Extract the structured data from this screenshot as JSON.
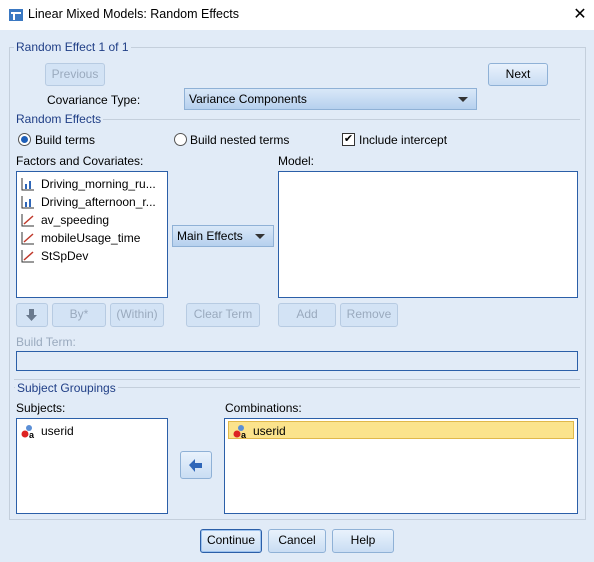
{
  "window": {
    "title": "Linear Mixed Models: Random Effects",
    "close": "✕"
  },
  "random_effect": {
    "group_title": "Random Effect 1 of 1",
    "previous": "Previous",
    "next": "Next",
    "covariance_label": "Covariance Type:",
    "covariance_value": "Variance Components"
  },
  "random_effects": {
    "group_title": "Random Effects",
    "build_terms": "Build terms",
    "build_nested": "Build nested terms",
    "include_intercept": "Include intercept",
    "include_intercept_checked": true,
    "selected_mode": "Build terms",
    "factors_label": "Factors and Covariates:",
    "factors": [
      {
        "name": "Driving_morning_ru...",
        "icon": "ordinal-icon"
      },
      {
        "name": "Driving_afternoon_r...",
        "icon": "ordinal-icon"
      },
      {
        "name": "av_speeding",
        "icon": "scale-icon"
      },
      {
        "name": "mobileUsage_time",
        "icon": "scale-icon"
      },
      {
        "name": "StSpDev",
        "icon": "scale-icon"
      }
    ],
    "term_type": "Main Effects",
    "model_label": "Model:",
    "by": "By*",
    "within": "(Within)",
    "clear_term": "Clear Term",
    "add": "Add",
    "remove": "Remove",
    "build_term_label": "Build Term:"
  },
  "subject_groupings": {
    "group_title": "Subject Groupings",
    "subjects_label": "Subjects:",
    "subjects": [
      "userid"
    ],
    "combinations_label": "Combinations:",
    "combinations": [
      "userid"
    ]
  },
  "footer": {
    "continue": "Continue",
    "cancel": "Cancel",
    "help": "Help"
  },
  "colors": {
    "background": "#e1ebf7",
    "selection": "#fbe38c",
    "accent": "#1f3e86"
  }
}
